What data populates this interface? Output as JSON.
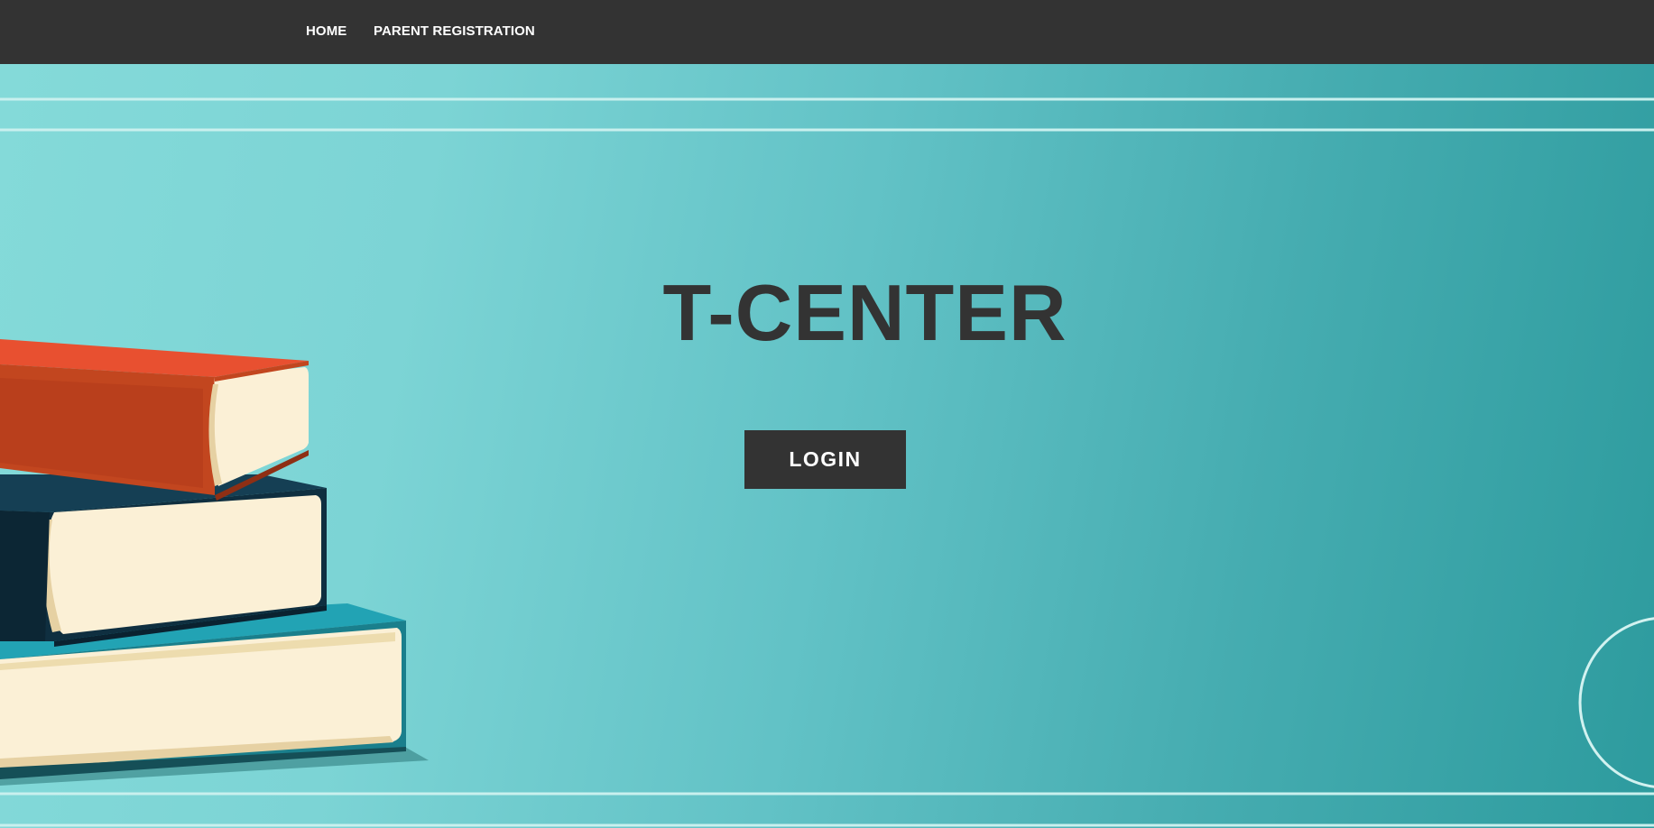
{
  "nav": {
    "home_label": "HOME",
    "parent_registration_label": "PARENT REGISTRATION"
  },
  "hero": {
    "title": "T-CENTER",
    "login_label": "LOGIN"
  },
  "colors": {
    "navbar": "#333333",
    "hero_light": "#84dad9",
    "hero_dark": "#2d9b9e",
    "title_text": "#333333",
    "button_bg": "#333333",
    "button_text": "#ffffff"
  }
}
